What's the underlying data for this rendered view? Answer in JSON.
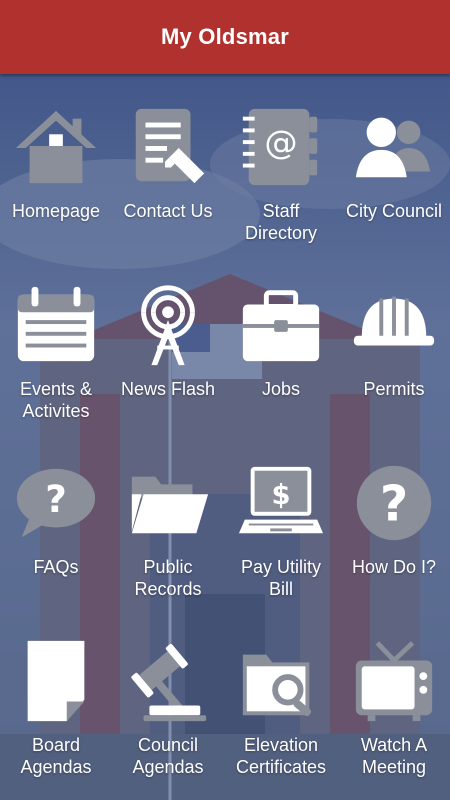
{
  "header": {
    "title": "My Oldsmar"
  },
  "colors": {
    "header": "#b1312e",
    "icon": "#8a8f99",
    "icon_light": "#ffffff",
    "label": "#ffffff"
  },
  "tiles": [
    {
      "label": "Homepage",
      "icon": "house-icon"
    },
    {
      "label": "Contact Us",
      "icon": "document-pencil-icon"
    },
    {
      "label": "Staff\nDirectory",
      "icon": "address-book-icon"
    },
    {
      "label": "City Council",
      "icon": "people-icon"
    },
    {
      "label": "Events &\nActivites",
      "icon": "calendar-icon"
    },
    {
      "label": "News Flash",
      "icon": "broadcast-tower-icon"
    },
    {
      "label": "Jobs",
      "icon": "briefcase-icon"
    },
    {
      "label": "Permits",
      "icon": "hard-hat-icon"
    },
    {
      "label": "FAQs",
      "icon": "question-bubble-icon"
    },
    {
      "label": "Public\nRecords",
      "icon": "folder-open-icon"
    },
    {
      "label": "Pay Utility\nBill",
      "icon": "laptop-dollar-icon"
    },
    {
      "label": "How Do I?",
      "icon": "question-circle-icon"
    },
    {
      "label": "Board\nAgendas",
      "icon": "page-icon"
    },
    {
      "label": "Council\nAgendas",
      "icon": "gavel-icon"
    },
    {
      "label": "Elevation\nCertificates",
      "icon": "folder-search-icon"
    },
    {
      "label": "Watch A\nMeeting",
      "icon": "tv-icon"
    }
  ]
}
